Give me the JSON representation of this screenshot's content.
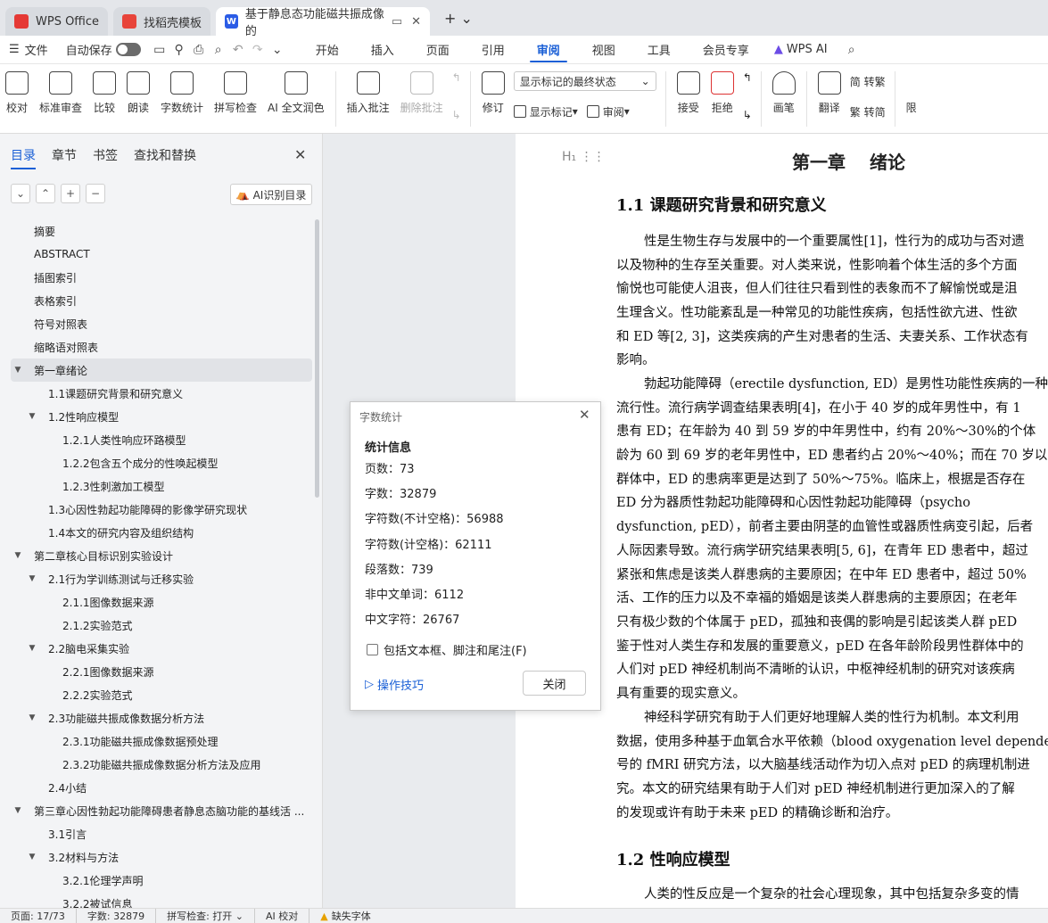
{
  "tabs": [
    {
      "label": "WPS Office",
      "icon": "wps-logo-icon",
      "color": "#e53935"
    },
    {
      "label": "找稻壳模板",
      "icon": "docer-logo-icon",
      "color": "#e8443a"
    },
    {
      "label": "基于静息态功能磁共振成像的",
      "icon": "word-doc-icon",
      "color": "#2b5ce6"
    }
  ],
  "menubar": {
    "file": "文件",
    "autosave": "自动保存",
    "items": [
      "开始",
      "插入",
      "页面",
      "引用",
      "审阅",
      "视图",
      "工具",
      "会员专享"
    ],
    "active": "审阅",
    "wps_ai": "WPS AI"
  },
  "ribbon": {
    "group1": [
      "校对",
      "标准审查",
      "比较",
      "朗读",
      "字数统计",
      "拼写检查",
      "AI 全文润色"
    ],
    "group2": [
      "插入批注",
      "删除批注"
    ],
    "revise": "修订",
    "show_markup_state": "显示标记的最终状态",
    "show_markup": "显示标记",
    "review": "审阅",
    "accept": "接受",
    "reject": "拒绝",
    "pen": "画笔",
    "translate": "翻译",
    "to_trad": "简 转繁",
    "to_simp": "繁 转简",
    "limit": "限"
  },
  "panel": {
    "tabs": [
      "目录",
      "章节",
      "书签",
      "查找和替换"
    ],
    "ai_toc": "AI识别目录",
    "toc": [
      {
        "label": "摘要",
        "level": 0,
        "caret": ""
      },
      {
        "label": "ABSTRACT",
        "level": 0,
        "caret": ""
      },
      {
        "label": "插图索引",
        "level": 0,
        "caret": ""
      },
      {
        "label": "表格索引",
        "level": 0,
        "caret": ""
      },
      {
        "label": "符号对照表",
        "level": 0,
        "caret": ""
      },
      {
        "label": "缩略语对照表",
        "level": 0,
        "caret": ""
      },
      {
        "label": "第一章绪论",
        "level": 0,
        "caret": "▼",
        "selected": true
      },
      {
        "label": "1.1课题研究背景和研究意义",
        "level": 1,
        "caret": ""
      },
      {
        "label": "1.2性响应模型",
        "level": 1,
        "caret": "▼"
      },
      {
        "label": "1.2.1人类性响应环路模型",
        "level": 2,
        "caret": ""
      },
      {
        "label": "1.2.2包含五个成分的性唤起模型",
        "level": 2,
        "caret": ""
      },
      {
        "label": "1.2.3性刺激加工模型",
        "level": 2,
        "caret": ""
      },
      {
        "label": "1.3心因性勃起功能障碍的影像学研究现状",
        "level": 1,
        "caret": ""
      },
      {
        "label": "1.4本文的研究内容及组织结构",
        "level": 1,
        "caret": ""
      },
      {
        "label": "第二章核心目标识别实验设计",
        "level": 0,
        "caret": "▼"
      },
      {
        "label": "2.1行为学训练测试与迁移实验",
        "level": 1,
        "caret": "▼"
      },
      {
        "label": "2.1.1图像数据来源",
        "level": 2,
        "caret": ""
      },
      {
        "label": "2.1.2实验范式",
        "level": 2,
        "caret": ""
      },
      {
        "label": "2.2脑电采集实验",
        "level": 1,
        "caret": "▼"
      },
      {
        "label": "2.2.1图像数据来源",
        "level": 2,
        "caret": ""
      },
      {
        "label": "2.2.2实验范式",
        "level": 2,
        "caret": ""
      },
      {
        "label": "2.3功能磁共振成像数据分析方法",
        "level": 1,
        "caret": "▼"
      },
      {
        "label": "2.3.1功能磁共振成像数据预处理",
        "level": 2,
        "caret": ""
      },
      {
        "label": "2.3.2功能磁共振成像数据分析方法及应用",
        "level": 2,
        "caret": ""
      },
      {
        "label": "2.4小结",
        "level": 1,
        "caret": ""
      },
      {
        "label": "第三章心因性勃起功能障碍患者静息态脑功能的基线活 ...",
        "level": 0,
        "caret": "▼"
      },
      {
        "label": "3.1引言",
        "level": 1,
        "caret": ""
      },
      {
        "label": "3.2材料与方法",
        "level": 1,
        "caret": "▼"
      },
      {
        "label": "3.2.1伦理学声明",
        "level": 2,
        "caret": ""
      },
      {
        "label": "3.2.2被试信息",
        "level": 2,
        "caret": ""
      }
    ]
  },
  "document": {
    "chapter": "第一章　 绪论",
    "h1": "1.1 课题研究背景和研究意义",
    "p1": [
      "性是生物生存与发展中的一个重要属性[1]，性行为的成功与否对遗",
      "以及物种的生存至关重要。对人类来说，性影响着个体生活的多个方面",
      "愉悦也可能使人沮丧，但人们往往只看到性的表象而不了解愉悦或是沮",
      "生理含义。性功能紊乱是一种常见的功能性疾病，包括性欲亢进、性欲",
      "和 ED 等[2, 3]，这类疾病的产生对患者的生活、夫妻关系、工作状态有",
      "影响。"
    ],
    "p2": [
      "勃起功能障碍（erectile dysfunction, ED）是男性功能性疾病的一种",
      "流行性。流行病学调查结果表明[4]，在小于 40 岁的成年男性中，有 1",
      "患有 ED；在年龄为 40 到 59 岁的中年男性中，约有 20%～30%的个体",
      "龄为 60 到 69 岁的老年男性中，ED 患者约占 20%～40%；而在 70 岁以",
      "群体中，ED 的患病率更是达到了 50%～75%。临床上，根据是否存在",
      "ED 分为器质性勃起功能障碍和心因性勃起功能障碍（psycho",
      "dysfunction, pED），前者主要由阴茎的血管性或器质性病变引起，后者",
      "人际因素导致。流行病学研究结果表明[5, 6]，在青年 ED 患者中，超过",
      "紧张和焦虑是该类人群患病的主要原因；在中年 ED 患者中，超过 50%",
      "活、工作的压力以及不幸福的婚姻是该类人群患病的主要原因；在老年",
      "只有极少数的个体属于 pED，孤独和丧偶的影响是引起该类人群 pED",
      "鉴于性对人类生存和发展的重要意义，pED 在各年龄阶段男性群体中的",
      "人们对 pED 神经机制尚不清晰的认识，中枢神经机制的研究对该疾病",
      "具有重要的现实意义。"
    ],
    "p3": [
      "神经科学研究有助于人们更好地理解人类的性行为机制。本文利用",
      "数据，使用多种基于血氧合水平依赖（blood oxygenation level depende",
      "号的 fMRI 研究方法，以大脑基线活动作为切入点对 pED 的病理机制进",
      "究。本文的研究结果有助于人们对 pED 神经机制进行更加深入的了解",
      "的发现或许有助于未来 pED 的精确诊断和治疗。"
    ],
    "h2": "1.2 性响应模型",
    "p4": [
      "人类的性反应是一个复杂的社会心理现象，其中包括复杂多变的情"
    ]
  },
  "dialog": {
    "title": "字数统计",
    "heading": "统计信息",
    "rows": [
      {
        "label": "页数：",
        "value": "73"
      },
      {
        "label": "字数：",
        "value": "32879"
      },
      {
        "label": "字符数(不计空格)：",
        "value": "56988"
      },
      {
        "label": "字符数(计空格)：",
        "value": "62111"
      },
      {
        "label": "段落数：",
        "value": "739"
      },
      {
        "label": "非中文单词：",
        "value": "6112"
      },
      {
        "label": "中文字符：",
        "value": "26767"
      }
    ],
    "checkbox": "包括文本框、脚注和尾注(F)",
    "tips": "操作技巧",
    "close": "关闭"
  },
  "statusbar": {
    "page": "页面: 17/73",
    "words": "字数: 32879",
    "spell": "拼写检查: 打开",
    "ai": "AI 校对",
    "font": "缺失字体"
  }
}
